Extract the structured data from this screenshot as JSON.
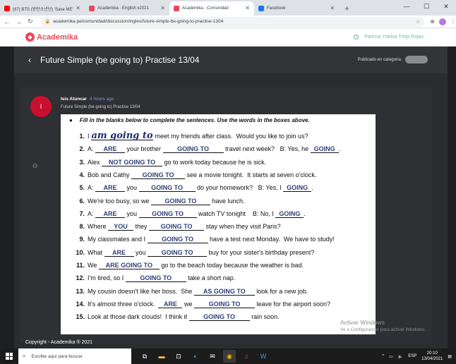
{
  "browser": {
    "tabs": [
      {
        "label": "(87) BTS (방탄소년단) 'Save ME'",
        "color": "#ff0000",
        "active": false
      },
      {
        "label": "Academika - English v2021",
        "color": "#e8485a",
        "active": false
      },
      {
        "label": "Academika - Comunidad",
        "color": "#e8485a",
        "active": true
      },
      {
        "label": "Facebook",
        "color": "#1877f2",
        "active": false
      }
    ],
    "new_tab": "+",
    "url": "academika.pe/comunidad/discussion/ingles/future-simple-be-going-to-practise-1304"
  },
  "site": {
    "logo": "Academika",
    "user_name": "Patricia Ydelsa Trejo Rojas"
  },
  "thread": {
    "title": "Future Simple (be going to) Practise 13/04",
    "published_label": "Publicado en categoría"
  },
  "post": {
    "avatar_letter": "I",
    "author": "Isis Atuncar",
    "time": "4 hours ago",
    "subject": "Future Simple (be going to) Practise 13/04"
  },
  "worksheet": {
    "instruction": "Fill in the blanks below to complete the sentences.  Use the words in the boxes above.",
    "items": [
      {
        "n": "1.",
        "parts": [
          "I ",
          {
            "a": "am going to",
            "w": 88,
            "hand": true
          },
          " meet my friends after class.  Would you like to join us?"
        ]
      },
      {
        "n": "2.",
        "parts": [
          "A: ",
          {
            "a": "ARE",
            "w": 42
          },
          " your brother ",
          {
            "a": "GOING TO",
            "w": 86
          },
          " travel next week?   B: Yes, he ",
          {
            "a": "GOING",
            "w": 40
          },
          "."
        ]
      },
      {
        "n": "3.",
        "parts": [
          "Alex ",
          {
            "a": "NOT GOING TO",
            "w": 86
          },
          " go to work today because he is sick."
        ]
      },
      {
        "n": "4.",
        "parts": [
          "Bob and Cathy ",
          {
            "a": "GOING TO",
            "w": 76
          },
          " see a movie tonight.  It starts at seven o'clock."
        ]
      },
      {
        "n": "5.",
        "parts": [
          "A: ",
          {
            "a": "ARE",
            "w": 42
          },
          " you ",
          {
            "a": "GOING TO",
            "w": 80
          },
          " do your homework?   B: Yes, I ",
          {
            "a": "GOING",
            "w": 40
          },
          "."
        ]
      },
      {
        "n": "6.",
        "parts": [
          "We're too busy, so we ",
          {
            "a": "GOING TO",
            "w": 84
          },
          " have lunch."
        ]
      },
      {
        "n": "7.",
        "parts": [
          "A: ",
          {
            "a": "ARE",
            "w": 42
          },
          " you ",
          {
            "a": "GOING TO",
            "w": 82
          },
          " watch TV tonight    B: No, I ",
          {
            "a": "GOING",
            "w": 40
          },
          "."
        ]
      },
      {
        "n": "8.",
        "parts": [
          "Where ",
          {
            "a": "YOU",
            "w": 36
          },
          " they ",
          {
            "a": "GOING TO",
            "w": 78
          },
          " stay when they visit Paris?"
        ]
      },
      {
        "n": "9.",
        "parts": [
          "My classmates and I ",
          {
            "a": "GOING TO",
            "w": 86
          },
          " have a test next Monday.  We have to study!"
        ]
      },
      {
        "n": "10.",
        "parts": [
          "What ",
          {
            "a": "ARE",
            "w": 42
          },
          " you ",
          {
            "a": "GOING TO",
            "w": 84
          },
          " buy for your sister's birthday present?"
        ]
      },
      {
        "n": "11.",
        "parts": [
          "We ",
          {
            "a": "ARE GOING TO",
            "w": 86
          },
          " go to the beach today because the weather is bad."
        ]
      },
      {
        "n": "12.",
        "parts": [
          "I'm tired, so I ",
          {
            "a": "GOING TO",
            "w": 86
          },
          " take a short nap."
        ]
      },
      {
        "n": "13.",
        "parts": [
          "My cousin doesn't like her boss.  She ",
          {
            "a": "AS GOING TO",
            "w": 86
          },
          " look for a new job."
        ]
      },
      {
        "n": "14.",
        "parts": [
          "It's almost three o'clock.  ",
          {
            "a": "ARE",
            "w": 34
          },
          " we ",
          {
            "a": "GOING TO",
            "w": 86
          },
          " leave for the airport soon?"
        ]
      },
      {
        "n": "15.",
        "parts": [
          "Look at those dark clouds!  I think it ",
          {
            "a": "GOING TO",
            "w": 86
          },
          " rain soon."
        ]
      }
    ]
  },
  "footer": "Copyright - Academika ® 2021",
  "watermark": {
    "line1": "Activar Windows",
    "line2": "Ve a Configuración para activar Windows."
  },
  "taskbar": {
    "search_placeholder": "Escribe aquí para buscar",
    "lang": "ESP",
    "time": "20:10",
    "date": "13/04/2021"
  }
}
